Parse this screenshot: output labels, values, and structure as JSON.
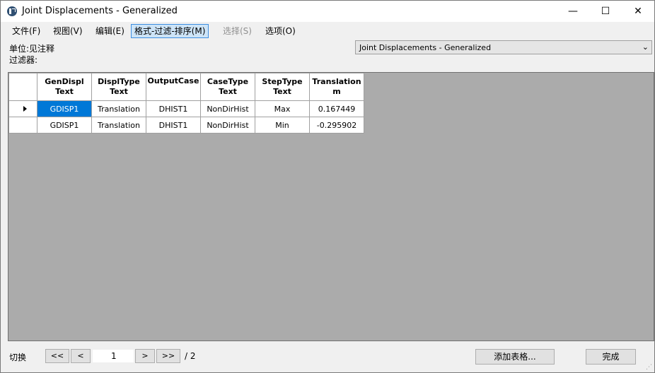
{
  "window": {
    "title": "Joint Displacements - Generalized",
    "minimize": "—",
    "maximize": "☐",
    "close": "✕"
  },
  "menu": [
    {
      "label": "文件(F)"
    },
    {
      "label": "视图(V)"
    },
    {
      "label": "编辑(E)"
    },
    {
      "label": "格式-过滤-排序(M)"
    },
    {
      "label": "选择(S)"
    },
    {
      "label": "选项(O)"
    }
  ],
  "info": {
    "units": "单位:见注释",
    "filter": "过滤器:"
  },
  "table_select": {
    "value": "Joint Displacements - Generalized",
    "chevron": "⌄"
  },
  "grid": {
    "headers": [
      [
        "GenDispl",
        "Text"
      ],
      [
        "DisplType",
        "Text"
      ],
      [
        "OutputCase",
        ""
      ],
      [
        "CaseType",
        "Text"
      ],
      [
        "StepType",
        "Text"
      ],
      [
        "Translation",
        "m"
      ]
    ],
    "rows": [
      [
        "GDISP1",
        "Translation",
        "DHIST1",
        "NonDirHist",
        "Max",
        "0.167449"
      ],
      [
        "GDISP1",
        "Translation",
        "DHIST1",
        "NonDirHist",
        "Min",
        "-0.295902"
      ]
    ]
  },
  "pager": {
    "label": "切换",
    "first": "<<",
    "prev": "<",
    "page": "1",
    "next": ">",
    "last": ">>",
    "total": "/ 2"
  },
  "buttons": {
    "add_table": "添加表格...",
    "done": "完成"
  },
  "colors": {
    "selection": "#0078d7",
    "grid_bg": "#ababab",
    "menu_active": "#cde4f7"
  }
}
